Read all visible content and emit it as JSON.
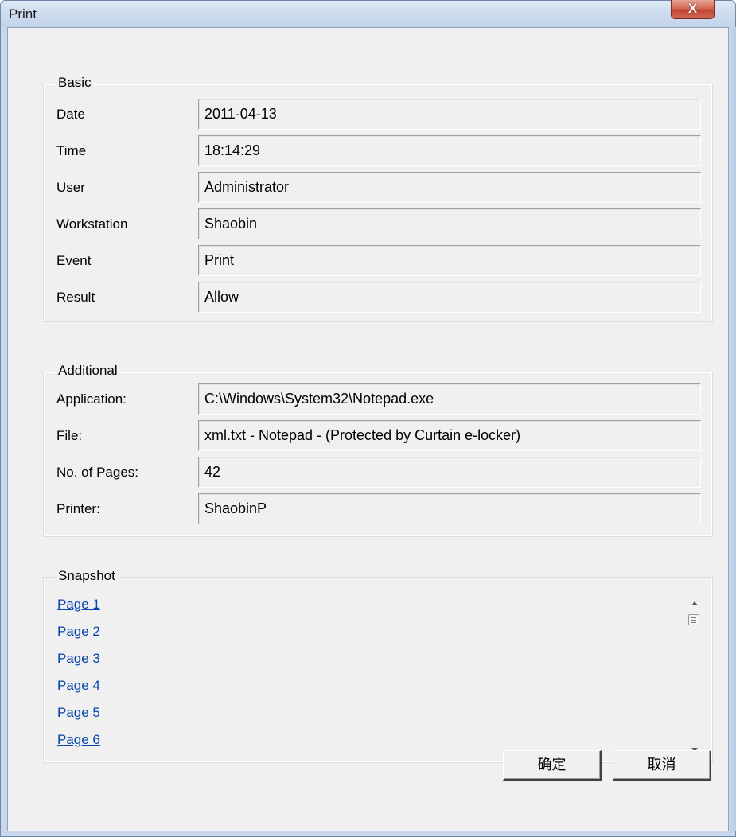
{
  "window": {
    "title": "Print",
    "close_label": "X"
  },
  "basic": {
    "legend": "Basic",
    "rows": [
      {
        "label": "Date",
        "value": "2011-04-13"
      },
      {
        "label": "Time",
        "value": "18:14:29"
      },
      {
        "label": "User",
        "value": "Administrator"
      },
      {
        "label": "Workstation",
        "value": "Shaobin"
      },
      {
        "label": "Event",
        "value": "Print"
      },
      {
        "label": "Result",
        "value": "Allow"
      }
    ]
  },
  "additional": {
    "legend": "Additional",
    "rows": [
      {
        "label": "Application:",
        "value": "C:\\Windows\\System32\\Notepad.exe"
      },
      {
        "label": "File:",
        "value": "xml.txt - Notepad - (Protected by Curtain e-locker)"
      },
      {
        "label": "No. of Pages:",
        "value": "42"
      },
      {
        "label": "Printer:",
        "value": "ShaobinP"
      }
    ]
  },
  "snapshot": {
    "legend": "Snapshot",
    "links": [
      "Page 1",
      "Page 2",
      "Page 3",
      "Page 4",
      "Page 5",
      "Page 6"
    ]
  },
  "buttons": {
    "ok_label": "确定",
    "cancel_label": "取消"
  }
}
